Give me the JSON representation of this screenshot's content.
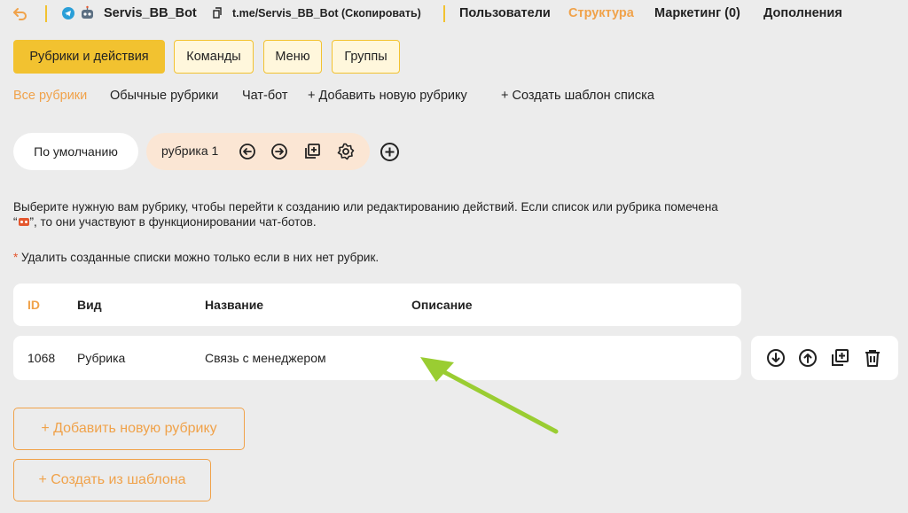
{
  "topbar": {
    "bot_name": "Servis_BB_Bot",
    "bot_link": "t.me/Servis_BB_Bot (Скопировать)",
    "nav": [
      "Пользователи",
      "Структура",
      "Маркетинг (0)",
      "Дополнения"
    ],
    "active_nav": "Структура",
    "icons": [
      "back-icon",
      "telegram-icon",
      "bot-avatar-icon",
      "copy-link-icon"
    ]
  },
  "tabs": [
    "Рубрики и действия",
    "Команды",
    "Меню",
    "Группы"
  ],
  "filters": [
    "Все рубрики",
    "Обычные рубрики",
    "Чат-бот",
    "+ Добавить новую рубрику",
    "+ Создать шаблон списка"
  ],
  "lists": {
    "default_label": "По умолчанию",
    "rubric_label": "рубрика 1",
    "rubric_icons": [
      "arrow-left-circle-icon",
      "arrow-right-circle-icon",
      "duplicate-icon",
      "settings-gear-icon"
    ],
    "add_icon": "plus-circle-icon"
  },
  "info": {
    "line1": "Выберите нужную вам рубрику, чтобы перейти к созданию или редактированию действий. Если список или рубрика помечена",
    "line2_prefix": "“",
    "line2_suffix": "”, то они участвуют в функционировании чат-ботов.",
    "note_star": "*",
    "note": " Удалить созданные списки можно только если в них нет рубрик."
  },
  "table": {
    "headers": {
      "id": "ID",
      "type": "Вид",
      "name": "Название",
      "description": "Описание"
    },
    "rows": [
      {
        "id": "1068",
        "type": "Рубрика",
        "name": "Связь с менеджером",
        "description": ""
      }
    ],
    "row_actions": [
      "move-down-icon",
      "move-up-icon",
      "duplicate-icon",
      "delete-icon"
    ]
  },
  "buttons": {
    "add_rubric": "+ Добавить новую рубрику",
    "from_template": "+ Создать из шаблона"
  },
  "colors": {
    "accent_orange": "#f0a24a",
    "accent_yellow": "#f2c230",
    "background": "#ececec",
    "pill_peach": "#fbe6d4",
    "arrow_green": "#9acd32"
  }
}
